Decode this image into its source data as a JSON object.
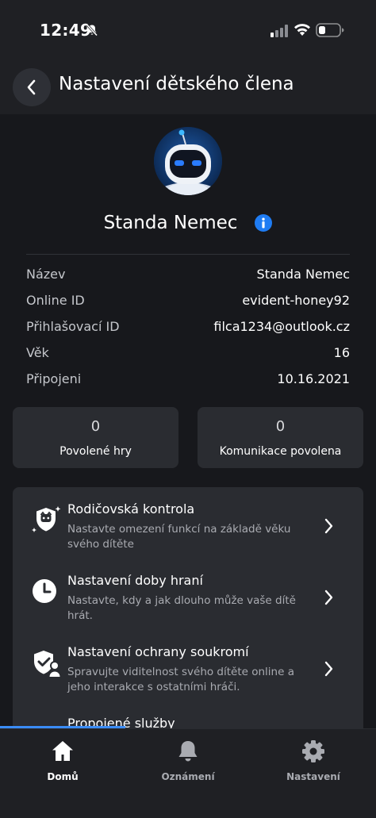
{
  "status_bar": {
    "time": "12:49"
  },
  "header": {
    "title": "Nastavení dětského člena"
  },
  "profile": {
    "name": "Standa Nemec"
  },
  "details": [
    {
      "label": "Název",
      "value": "Standa Nemec"
    },
    {
      "label": "Online ID",
      "value": "evident-honey92"
    },
    {
      "label": "Přihlašovací ID",
      "value": "filca1234@outlook.cz"
    },
    {
      "label": "Věk",
      "value": "16"
    },
    {
      "label": "Připojeni",
      "value": "10.16.2021"
    }
  ],
  "stats": [
    {
      "count": "0",
      "label": "Povolené hry"
    },
    {
      "count": "0",
      "label": "Komunikace povolena"
    }
  ],
  "settings": [
    {
      "title": "Rodičovská kontrola",
      "description": "Nastavte omezení funkcí na základě věku svého dítěte",
      "icon": "parental-shield-icon"
    },
    {
      "title": "Nastavení doby hraní",
      "description": "Nastavte, kdy a jak dlouho může vaše dítě hrát.",
      "icon": "clock-icon"
    },
    {
      "title": "Nastavení ochrany soukromí",
      "description": "Spravujte viditelnost svého dítěte online a jeho interakce s ostatními hráči.",
      "icon": "privacy-shield-icon"
    },
    {
      "title": "Propojené služby",
      "description": "",
      "icon": ""
    }
  ],
  "tab_bar": {
    "tabs": [
      {
        "label": "Domů",
        "icon": "home-icon",
        "active": true
      },
      {
        "label": "Oznámení",
        "icon": "bell-icon",
        "active": false
      },
      {
        "label": "Nastavení",
        "icon": "gear-icon",
        "active": false
      }
    ]
  },
  "colors": {
    "background": "#17181c",
    "card": "#2a2c31",
    "accent": "#1f7cf3",
    "active_tab": "#ffffff",
    "inactive_tab": "#a9abb1"
  }
}
